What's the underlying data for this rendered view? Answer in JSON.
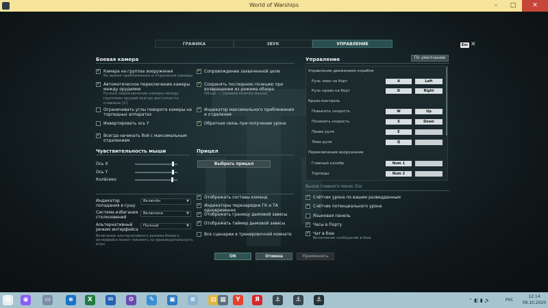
{
  "window": {
    "title": "World of Warships",
    "minimize": "–",
    "maximize": "□",
    "close": "✕"
  },
  "tabs": [
    {
      "label": "ГРАФИКА",
      "active": false
    },
    {
      "label": "ЗВУК",
      "active": false
    },
    {
      "label": "УПРАВЛЕНИЕ",
      "active": true
    }
  ],
  "esc": {
    "badge": "Esc",
    "close": "✕"
  },
  "battle_camera": {
    "title": "Боевая камера",
    "left": [
      {
        "label": "Камера на группах вооружения",
        "sub": "Во время приближения и отдаления камеры",
        "checked": true
      },
      {
        "label": "Автоматическое переключение камеры между орудиями",
        "sub": "Ручное переключение камеры между группами орудий всегда доступно по клавише [C]",
        "checked": true
      },
      {
        "label": "Ограничивать углы поворота камеры на торпедных аппаратах",
        "sub": "",
        "checked": false
      },
      {
        "label": "Инвертировать ось Y",
        "sub": "",
        "checked": false
      },
      {
        "label": "Всегда начинать бой с максимальным отдалением",
        "sub": "",
        "checked": true
      }
    ],
    "right": [
      {
        "label": "Сопровождение захваченной цели",
        "sub": "",
        "checked": true
      },
      {
        "label": "Сохранять последнюю позицию при возвращении из режима обзора",
        "sub": "Обзор — [правая кнопка мыши]",
        "checked": true
      },
      {
        "label": "Индикатор максимального приближения и отдаления",
        "sub": "",
        "checked": true
      },
      {
        "label": "Обратная связь при получении урона",
        "sub": "",
        "checked": true
      }
    ]
  },
  "mouse": {
    "title": "Чувствительность мыши",
    "sliders": [
      {
        "label": "Ось X",
        "value": 0.9
      },
      {
        "label": "Ось Y",
        "value": 0.9
      },
      {
        "label": "Колёсико",
        "value": 0.88
      }
    ]
  },
  "sight": {
    "title": "Прицел",
    "button": "Выбрать прицел"
  },
  "selects": [
    {
      "label": "Индикатор попадания в сушу",
      "value": "Включён"
    },
    {
      "label": "Система избегания столкновений",
      "value": "Включена"
    },
    {
      "label": "Альтернативный режим интерфейса",
      "value": "Полный"
    }
  ],
  "selects_note": "Включение альтернативного режима боевого интерфейса может повлиять на производительность игры",
  "middle_checks": [
    {
      "label": "Отображать составы команд",
      "checked": true
    },
    {
      "label": "Индикаторы перезарядки ГК и ТА одновременно",
      "checked": true
    },
    {
      "label": "Отображать границу дымовой завесы",
      "checked": true
    },
    {
      "label": "Отображать таймер дымовой завесы",
      "checked": true
    },
    {
      "label": "Все сценарии в тренировочной комнате",
      "checked": false
    }
  ],
  "controls": {
    "title": "Управление",
    "default_button": "По умолчанию",
    "groups": [
      {
        "name": "Управление движением корабля",
        "actions": [
          {
            "label": "Руль лево на борт",
            "key1": "A",
            "key2": "Left"
          },
          {
            "label": "Руль право на борт",
            "key1": "D",
            "key2": "Right"
          }
        ]
      },
      {
        "name": "Круиз-контроль",
        "actions": [
          {
            "label": "Повысить скорость",
            "key1": "W",
            "key2": "Up"
          },
          {
            "label": "Понизить скорость",
            "key1": "S",
            "key2": "Down"
          },
          {
            "label": "Право руля",
            "key1": "E",
            "key2": ""
          },
          {
            "label": "Лево руля",
            "key1": "Q",
            "key2": ""
          }
        ]
      },
      {
        "name": "Переключение вооружения",
        "actions": [
          {
            "label": "Главный калибр",
            "key1": "Num 1",
            "key2": ""
          },
          {
            "label": "Торпеды",
            "key1": "Num 2",
            "key2": ""
          }
        ]
      }
    ],
    "main_menu_hint": "Вызов главного меню: Esc"
  },
  "right_checks": [
    {
      "label": "Счётчик урона по вашим разведданным",
      "sub": "",
      "checked": true
    },
    {
      "label": "Счётчик потенциального урона",
      "sub": "",
      "checked": true
    },
    {
      "label": "Языковая панель",
      "sub": "",
      "checked": false
    },
    {
      "label": "Часы в Порту",
      "sub": "",
      "checked": true
    },
    {
      "label": "Чат в бою",
      "sub": "Включение сообщений в бою",
      "checked": true
    }
  ],
  "footer": {
    "ok": "ОК",
    "cancel": "Отмена",
    "apply": "Применить"
  },
  "taskbar": {
    "icons": [
      {
        "name": "windows-logo-icon",
        "glyph": "⊞",
        "color": "#e8eef0"
      },
      {
        "name": "alice-assistant-icon",
        "glyph": "◉",
        "color": "#8b5cf6"
      },
      {
        "name": "onedrive-folder-icon",
        "glyph": "▭",
        "color": "#7d8da6"
      },
      {
        "name": "edge-browser-icon",
        "glyph": "e",
        "color": "#1a73c8"
      },
      {
        "name": "excel-icon",
        "glyph": "X",
        "color": "#1f7a3f"
      },
      {
        "name": "mail-icon",
        "glyph": "✉",
        "color": "#2562b5"
      },
      {
        "name": "settings-icon",
        "glyph": "⚙",
        "color": "#6a4ab0"
      },
      {
        "name": "paint-icon",
        "glyph": "✎",
        "color": "#3c8fd2"
      },
      {
        "name": "remote-desktop-icon",
        "glyph": "▣",
        "color": "#2d7ac2"
      },
      {
        "name": "notepad-icon",
        "glyph": "≡",
        "color": "#8ab3d0"
      },
      {
        "name": "file-explorer-icon",
        "glyph": "▤",
        "color": "#e0b43e"
      },
      {
        "name": "calculator-icon",
        "glyph": "▦",
        "color": "#5d6f7c"
      },
      {
        "name": "yandex-browser-icon",
        "glyph": "Y",
        "color": "#e8402c"
      },
      {
        "name": "yandex-icon",
        "glyph": "Я",
        "color": "#d8252a"
      },
      {
        "name": "wows-launcher-icon",
        "glyph": "⚓",
        "color": "#37474f"
      },
      {
        "name": "wows-launcher-2-icon",
        "glyph": "⚓",
        "color": "#37474f"
      },
      {
        "name": "wows-game-icon",
        "glyph": "⚓",
        "color": "#263238"
      }
    ],
    "language": "РУС",
    "time": "12:14",
    "date": "09.10.2020"
  },
  "colors": {
    "accent": "#2a4f50",
    "checked": "#b8e07a",
    "title_bar": "#f5e49a",
    "taskbar": "#a5c4d0"
  }
}
